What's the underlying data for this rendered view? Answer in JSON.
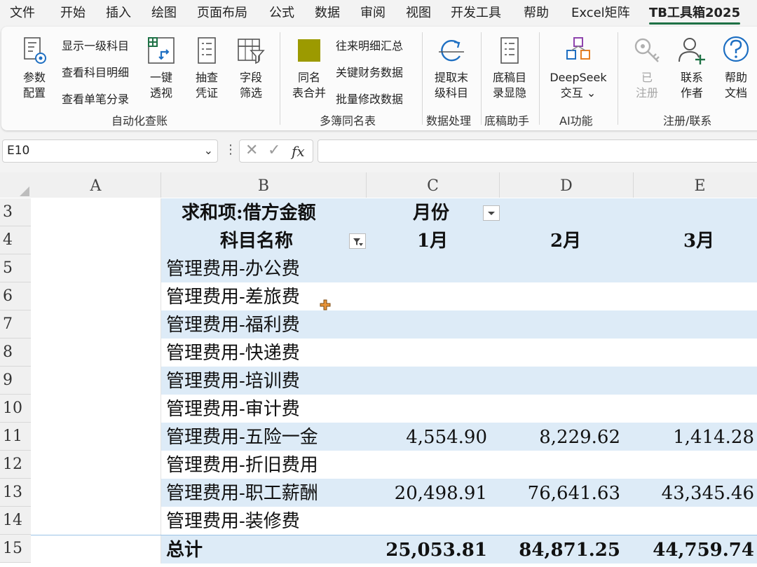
{
  "tabs": [
    "文件",
    "开始",
    "插入",
    "绘图",
    "页面布局",
    "公式",
    "数据",
    "审阅",
    "视图",
    "开发工具",
    "帮助",
    "Excel矩阵",
    "TB工具箱2025"
  ],
  "ribbon": {
    "auto_group": {
      "param_config": [
        "参数",
        "配置"
      ],
      "show_level1": "显示一级科目",
      "view_detail": "查看科目明细",
      "view_single": "查看单笔分录",
      "one_key": [
        "一键",
        "透视"
      ],
      "sample_voucher": [
        "抽查",
        "凭证"
      ],
      "field_filter": [
        "字段",
        "筛选"
      ],
      "label": "自动化查账"
    },
    "multi_group": {
      "same_name_merge": [
        "同名",
        "表合并"
      ],
      "ar_summary": "往来明细汇总",
      "key_finance": "关键财务数据",
      "batch_modify": "批量修改数据",
      "label": "多簿同名表",
      "swatch_color": "#9c9a00"
    },
    "data_group": {
      "extract_last": [
        "提取末",
        "级科目"
      ],
      "label": "数据处理"
    },
    "draft_group": {
      "draft_toggle": [
        "底稿目",
        "录显隐"
      ],
      "label": "底稿助手"
    },
    "ai_group": {
      "deepseek": [
        "DeepSeek",
        "交互 ⌄"
      ],
      "label": "AI功能"
    },
    "reg_group": {
      "registered": [
        "已",
        "注册"
      ],
      "contact": [
        "联系",
        "作者"
      ],
      "help": [
        "帮助",
        "文档"
      ],
      "label": "注册/联系"
    }
  },
  "formula_bar": {
    "name_box": "E10",
    "fx": "fx",
    "formula": ""
  },
  "columns": [
    "A",
    "B",
    "C",
    "D",
    "E"
  ],
  "rows": [
    "3",
    "4",
    "5",
    "6",
    "7",
    "8",
    "9",
    "10",
    "11",
    "12",
    "13",
    "14",
    "15"
  ],
  "pivot": {
    "header1": {
      "label": "求和项:借方金额",
      "col_field": "月份"
    },
    "header2": {
      "row_field": "科目名称",
      "months": [
        "1月",
        "2月",
        "3月"
      ]
    },
    "body": [
      {
        "name": "管理费用-办公费",
        "values": [
          "",
          "",
          ""
        ]
      },
      {
        "name": "管理费用-差旅费",
        "values": [
          "",
          "",
          ""
        ]
      },
      {
        "name": "管理费用-福利费",
        "values": [
          "",
          "",
          ""
        ]
      },
      {
        "name": "管理费用-快递费",
        "values": [
          "",
          "",
          ""
        ]
      },
      {
        "name": "管理费用-培训费",
        "values": [
          "",
          "",
          ""
        ]
      },
      {
        "name": "管理费用-审计费",
        "values": [
          "",
          "",
          ""
        ]
      },
      {
        "name": "管理费用-五险一金",
        "values": [
          "4,554.90",
          "8,229.62",
          "1,414.28"
        ]
      },
      {
        "name": "管理费用-折旧费用",
        "values": [
          "",
          "",
          ""
        ]
      },
      {
        "name": "管理费用-职工薪酬",
        "values": [
          "20,498.91",
          "76,641.63",
          "43,345.46"
        ]
      },
      {
        "name": "管理费用-装修费",
        "values": [
          "",
          "",
          ""
        ]
      }
    ],
    "total": {
      "name": "总计",
      "values": [
        "25,053.81",
        "84,871.25",
        "44,759.74"
      ]
    }
  },
  "colors": {
    "band_blue": "#ddebf7",
    "accent_green": "#1e7145",
    "icon_blue": "#1e6fc2"
  }
}
